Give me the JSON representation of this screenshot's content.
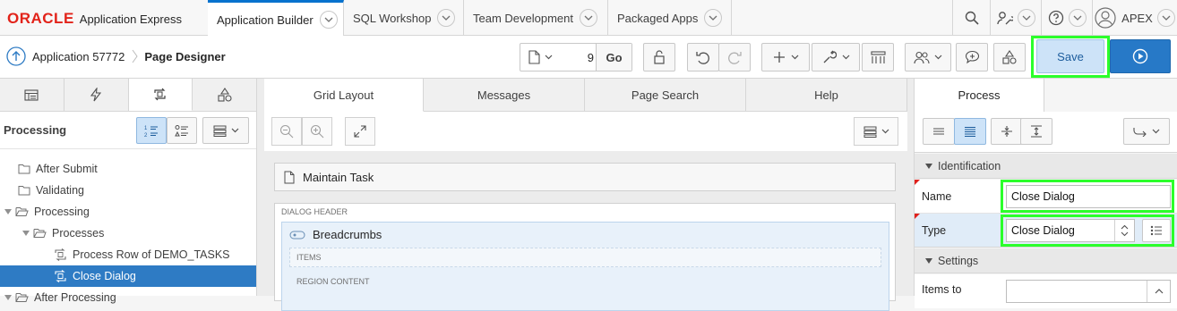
{
  "brand": {
    "oracle": "ORACLE",
    "product": "Application Express"
  },
  "nav": {
    "tabs": [
      {
        "label": "Application Builder"
      },
      {
        "label": "SQL Workshop"
      },
      {
        "label": "Team Development"
      },
      {
        "label": "Packaged Apps"
      }
    ],
    "user": "APEX"
  },
  "toolbar": {
    "breadcrumb_app": "Application 57772",
    "breadcrumb_page": "Page Designer",
    "page_number": "9",
    "go_label": "Go",
    "save_label": "Save"
  },
  "left": {
    "panel_title": "Processing",
    "tree": [
      {
        "label": "After Submit"
      },
      {
        "label": "Validating"
      },
      {
        "label": "Processing"
      },
      {
        "label": "Processes"
      },
      {
        "label": "Process Row of DEMO_TASKS"
      },
      {
        "label": "Close Dialog"
      },
      {
        "label": "After Processing"
      }
    ]
  },
  "center": {
    "tabs": [
      {
        "label": "Grid Layout"
      },
      {
        "label": "Messages"
      },
      {
        "label": "Page Search"
      },
      {
        "label": "Help"
      }
    ],
    "page_region": "Maintain Task",
    "dialog_header": "DIALOG HEADER",
    "breadcrumbs_region": "Breadcrumbs",
    "items_label": "ITEMS",
    "region_content_label": "REGION CONTENT"
  },
  "right": {
    "tab": "Process",
    "groups": {
      "identification": "Identification",
      "settings": "Settings"
    },
    "props": {
      "name_label": "Name",
      "name_value": "Close Dialog",
      "type_label": "Type",
      "type_value": "Close Dialog",
      "items_to_label": "Items to"
    }
  },
  "colors": {
    "accent": "#0572ce",
    "selection": "#2e7bc4",
    "highlight": "#2bff2b",
    "oracle_red": "#e2231a"
  }
}
